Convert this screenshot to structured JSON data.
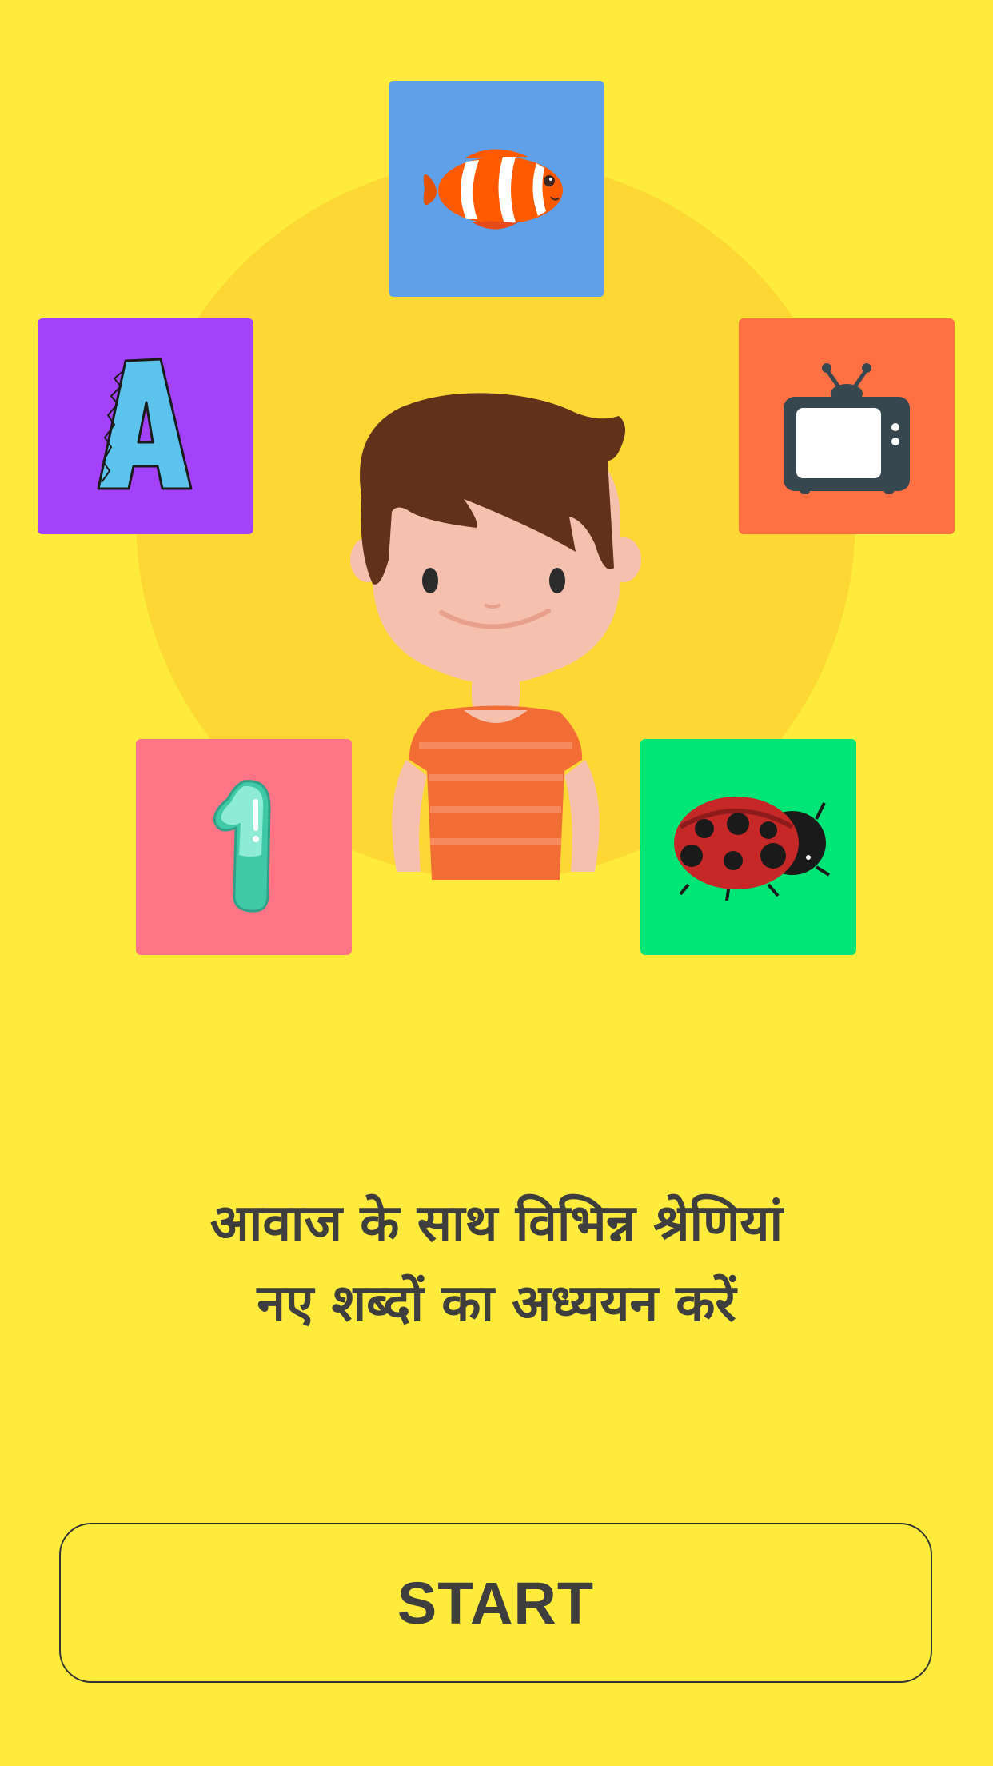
{
  "colors": {
    "background": "#FFEB3B",
    "halo": "#FDD835",
    "text": "#3E3E3E",
    "tile_fish": "#5FA0E8",
    "tile_letter": "#A342FA",
    "tile_tv": "#FF7043",
    "tile_number": "#FF7586",
    "tile_bug": "#00E676"
  },
  "categories": [
    {
      "id": "fish",
      "icon": "clownfish-icon"
    },
    {
      "id": "letter",
      "icon": "letter-a-icon"
    },
    {
      "id": "tv",
      "icon": "television-icon"
    },
    {
      "id": "number",
      "icon": "number-one-icon"
    },
    {
      "id": "bug",
      "icon": "ladybug-icon"
    }
  ],
  "mascot": "boy-mascot",
  "headline": {
    "line1": "आवाज के साथ विभिन्न श्रेणियां",
    "line2": "नए शब्दों का अध्ययन करें"
  },
  "start_button": {
    "label": "START"
  }
}
